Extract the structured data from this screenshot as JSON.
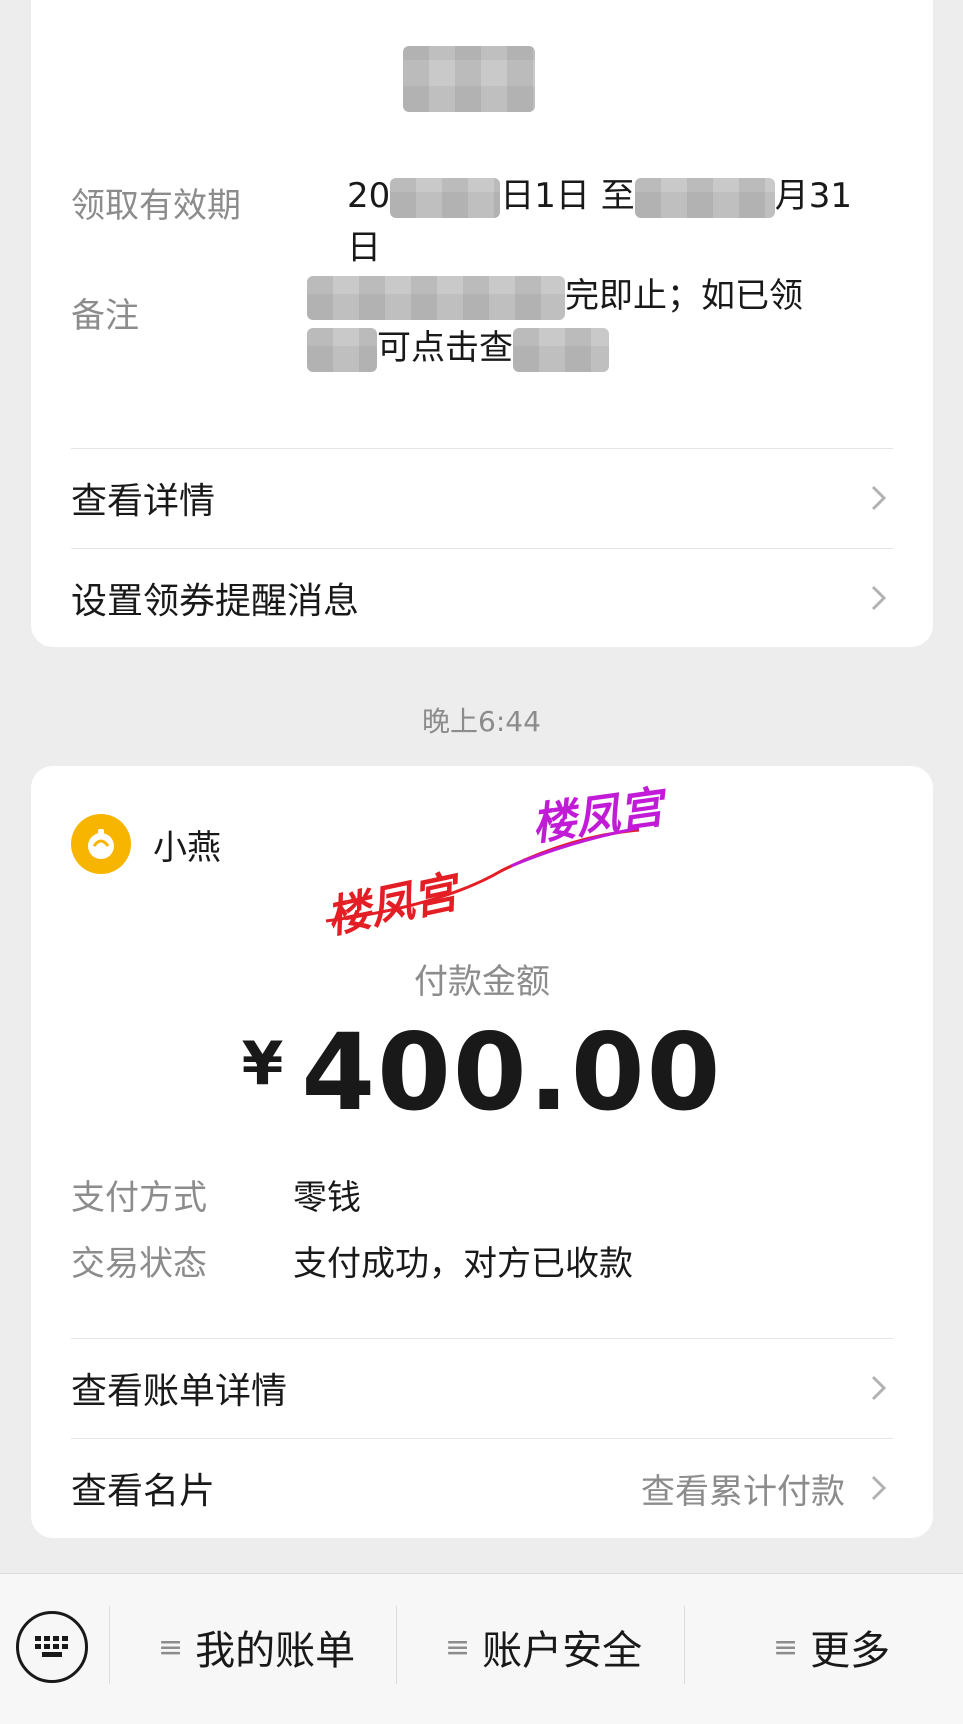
{
  "coupon_card": {
    "validity_label": "领取有效期",
    "validity_value_part1": "20",
    "validity_value_part2": "日1日 至",
    "validity_value_part3": "月31",
    "validity_value_line2": "日",
    "remark_label": "备注",
    "remark_value_part1": "完即止；如已领",
    "remark_value_part2": "可点击查",
    "view_details": "查看详情",
    "set_reminder": "设置领券提醒消息"
  },
  "timestamp": "晚上6:44",
  "payment_card": {
    "merchant_name": "小燕",
    "stamp_text": "楼凤宫",
    "amount_label": "付款金额",
    "currency": "¥",
    "amount": "400.00",
    "pay_method_label": "支付方式",
    "pay_method_value": "零钱",
    "status_label": "交易状态",
    "status_value": "支付成功，对方已收款",
    "view_bill": "查看账单详情",
    "view_card": "查看名片",
    "view_total": "查看累计付款"
  },
  "bottom_bar": {
    "items": [
      {
        "label": "我的账单"
      },
      {
        "label": "账户安全"
      },
      {
        "label": "更多"
      }
    ]
  },
  "colors": {
    "background": "#ededed",
    "card": "#ffffff",
    "secondary_text": "#8c8c8c",
    "merchant_logo": "#f7b500",
    "stamp_red": "#e31e24",
    "stamp_purple": "#c21bd8"
  }
}
